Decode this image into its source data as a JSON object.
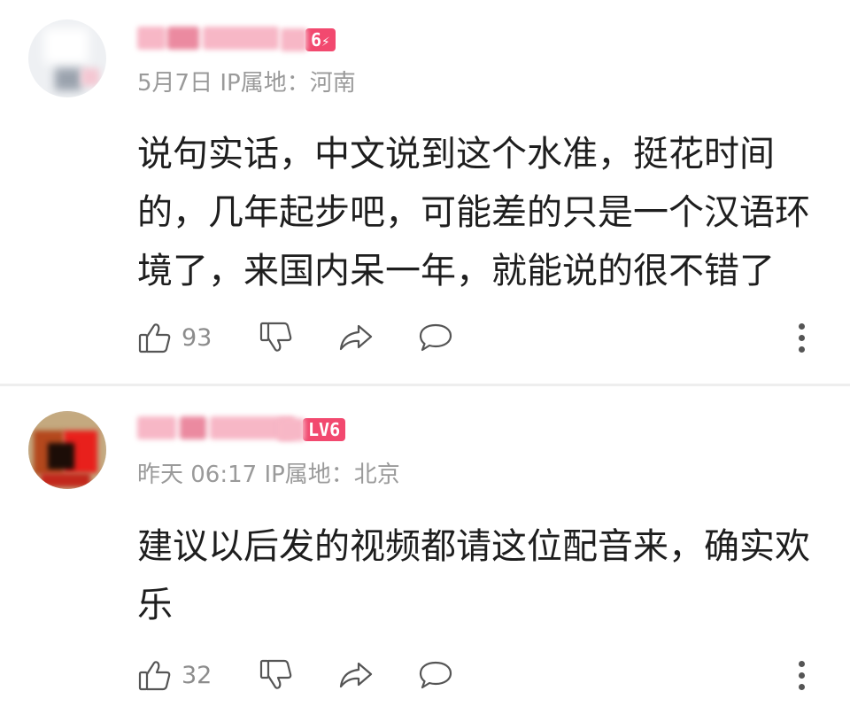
{
  "comments": [
    {
      "level_badge": "6",
      "level_bolt": "⚡",
      "meta": "5月7日 IP属地：河南",
      "content": "说句实话，中文说到这个水准，挺花时间的，几年起步吧，可能差的只是一个汉语环境了，来国内呆一年，就能说的很不错了",
      "like_count": "93"
    },
    {
      "level_badge": "LV6",
      "meta": "昨天 06:17 IP属地：北京",
      "content": "建议以后发的视频都请这位配音来，确实欢乐",
      "like_count": "32"
    }
  ],
  "icons": {
    "like": "thumbs-up-icon",
    "dislike": "thumbs-down-icon",
    "share": "share-arrow-icon",
    "reply": "speech-bubble-icon",
    "more": "vertical-dots-icon"
  },
  "colors": {
    "badge": "#f2496f",
    "meta_text": "#9a9a9a",
    "icon": "#555555"
  }
}
